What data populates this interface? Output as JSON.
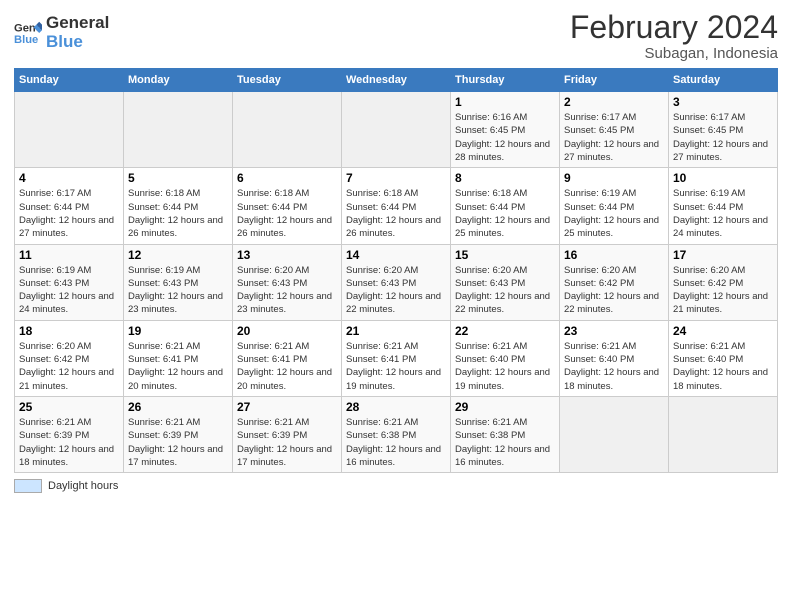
{
  "logo": {
    "line1": "General",
    "line2": "Blue"
  },
  "title": "February 2024",
  "subtitle": "Subagan, Indonesia",
  "days_of_week": [
    "Sunday",
    "Monday",
    "Tuesday",
    "Wednesday",
    "Thursday",
    "Friday",
    "Saturday"
  ],
  "legend_label": "Daylight hours",
  "weeks": [
    [
      {
        "day": "",
        "info": ""
      },
      {
        "day": "",
        "info": ""
      },
      {
        "day": "",
        "info": ""
      },
      {
        "day": "",
        "info": ""
      },
      {
        "day": "1",
        "info": "Sunrise: 6:16 AM\nSunset: 6:45 PM\nDaylight: 12 hours and 28 minutes."
      },
      {
        "day": "2",
        "info": "Sunrise: 6:17 AM\nSunset: 6:45 PM\nDaylight: 12 hours and 27 minutes."
      },
      {
        "day": "3",
        "info": "Sunrise: 6:17 AM\nSunset: 6:45 PM\nDaylight: 12 hours and 27 minutes."
      }
    ],
    [
      {
        "day": "4",
        "info": "Sunrise: 6:17 AM\nSunset: 6:44 PM\nDaylight: 12 hours and 27 minutes."
      },
      {
        "day": "5",
        "info": "Sunrise: 6:18 AM\nSunset: 6:44 PM\nDaylight: 12 hours and 26 minutes."
      },
      {
        "day": "6",
        "info": "Sunrise: 6:18 AM\nSunset: 6:44 PM\nDaylight: 12 hours and 26 minutes."
      },
      {
        "day": "7",
        "info": "Sunrise: 6:18 AM\nSunset: 6:44 PM\nDaylight: 12 hours and 26 minutes."
      },
      {
        "day": "8",
        "info": "Sunrise: 6:18 AM\nSunset: 6:44 PM\nDaylight: 12 hours and 25 minutes."
      },
      {
        "day": "9",
        "info": "Sunrise: 6:19 AM\nSunset: 6:44 PM\nDaylight: 12 hours and 25 minutes."
      },
      {
        "day": "10",
        "info": "Sunrise: 6:19 AM\nSunset: 6:44 PM\nDaylight: 12 hours and 24 minutes."
      }
    ],
    [
      {
        "day": "11",
        "info": "Sunrise: 6:19 AM\nSunset: 6:43 PM\nDaylight: 12 hours and 24 minutes."
      },
      {
        "day": "12",
        "info": "Sunrise: 6:19 AM\nSunset: 6:43 PM\nDaylight: 12 hours and 23 minutes."
      },
      {
        "day": "13",
        "info": "Sunrise: 6:20 AM\nSunset: 6:43 PM\nDaylight: 12 hours and 23 minutes."
      },
      {
        "day": "14",
        "info": "Sunrise: 6:20 AM\nSunset: 6:43 PM\nDaylight: 12 hours and 22 minutes."
      },
      {
        "day": "15",
        "info": "Sunrise: 6:20 AM\nSunset: 6:43 PM\nDaylight: 12 hours and 22 minutes."
      },
      {
        "day": "16",
        "info": "Sunrise: 6:20 AM\nSunset: 6:42 PM\nDaylight: 12 hours and 22 minutes."
      },
      {
        "day": "17",
        "info": "Sunrise: 6:20 AM\nSunset: 6:42 PM\nDaylight: 12 hours and 21 minutes."
      }
    ],
    [
      {
        "day": "18",
        "info": "Sunrise: 6:20 AM\nSunset: 6:42 PM\nDaylight: 12 hours and 21 minutes."
      },
      {
        "day": "19",
        "info": "Sunrise: 6:21 AM\nSunset: 6:41 PM\nDaylight: 12 hours and 20 minutes."
      },
      {
        "day": "20",
        "info": "Sunrise: 6:21 AM\nSunset: 6:41 PM\nDaylight: 12 hours and 20 minutes."
      },
      {
        "day": "21",
        "info": "Sunrise: 6:21 AM\nSunset: 6:41 PM\nDaylight: 12 hours and 19 minutes."
      },
      {
        "day": "22",
        "info": "Sunrise: 6:21 AM\nSunset: 6:40 PM\nDaylight: 12 hours and 19 minutes."
      },
      {
        "day": "23",
        "info": "Sunrise: 6:21 AM\nSunset: 6:40 PM\nDaylight: 12 hours and 18 minutes."
      },
      {
        "day": "24",
        "info": "Sunrise: 6:21 AM\nSunset: 6:40 PM\nDaylight: 12 hours and 18 minutes."
      }
    ],
    [
      {
        "day": "25",
        "info": "Sunrise: 6:21 AM\nSunset: 6:39 PM\nDaylight: 12 hours and 18 minutes."
      },
      {
        "day": "26",
        "info": "Sunrise: 6:21 AM\nSunset: 6:39 PM\nDaylight: 12 hours and 17 minutes."
      },
      {
        "day": "27",
        "info": "Sunrise: 6:21 AM\nSunset: 6:39 PM\nDaylight: 12 hours and 17 minutes."
      },
      {
        "day": "28",
        "info": "Sunrise: 6:21 AM\nSunset: 6:38 PM\nDaylight: 12 hours and 16 minutes."
      },
      {
        "day": "29",
        "info": "Sunrise: 6:21 AM\nSunset: 6:38 PM\nDaylight: 12 hours and 16 minutes."
      },
      {
        "day": "",
        "info": ""
      },
      {
        "day": "",
        "info": ""
      }
    ]
  ]
}
